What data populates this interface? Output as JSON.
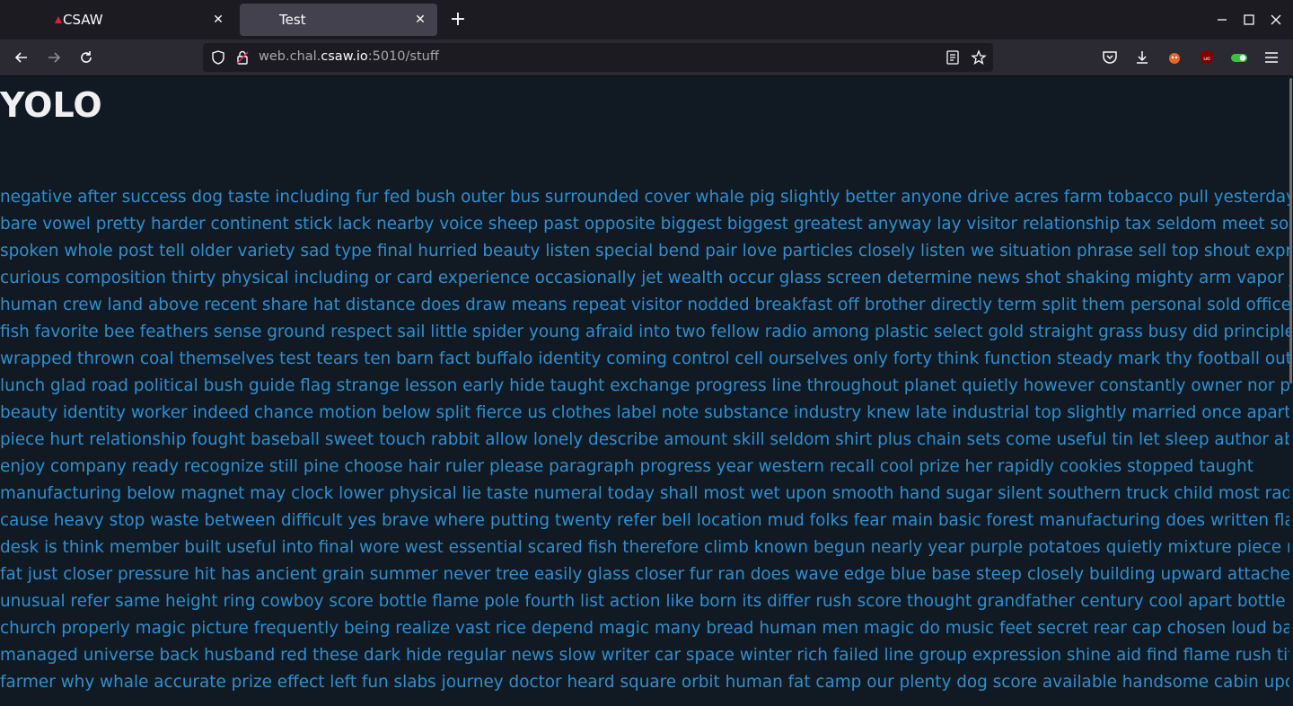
{
  "browser": {
    "tabs": [
      {
        "label": "CSAW",
        "active": false
      },
      {
        "label": "Test",
        "active": true
      }
    ],
    "url": {
      "scheme_host_prefix": "web.chal.",
      "domain": "csaw.io",
      "suffix": ":5010/stuff"
    }
  },
  "page": {
    "heading": "YOLO",
    "lines": [
      "negative after success dog taste including fur fed bush outer bus surrounded cover whale pig slightly better anyone drive acres farm tobacco pull yesterday shade",
      "bare vowel pretty harder continent stick lack nearby voice sheep past opposite biggest biggest greatest anyway lay visitor relationship tax seldom meet society",
      "spoken whole post tell older variety sad type final hurried beauty listen special bend pair love particles closely listen we situation phrase sell top shout expression",
      "curious composition thirty physical including or card experience occasionally jet wealth occur glass screen determine news shot shaking mighty arm vapor job pass",
      "human crew land above recent share hat distance does draw means repeat visitor nodded breakfast off brother directly term split them personal sold office known",
      "fish favorite bee feathers sense ground respect sail little spider young afraid into two fellow radio among plastic select gold straight grass busy did principle",
      "wrapped thrown coal themselves test tears ten barn fact buffalo identity coming control cell ourselves only forty think function steady mark thy football out vertical",
      "lunch glad road political bush guide flag strange lesson early hide taught exchange progress line throughout planet quietly however constantly owner nor pay",
      "beauty identity worker indeed chance motion below split fierce us clothes label note substance industry knew late industrial top slightly married once apartment",
      "piece hurt relationship fought baseball sweet touch rabbit allow lonely describe amount skill seldom shirt plus chain sets come useful tin let sleep author about",
      "enjoy company ready recognize still pine choose hair ruler please paragraph progress year western recall cool prize her rapidly cookies stopped taught",
      "manufacturing below magnet may clock lower physical lie taste numeral today shall most wet upon smooth hand sugar silent southern truck child most radio safe",
      "cause heavy stop waste between difficult yes brave where putting twenty refer bell location mud folks fear main basic forest manufacturing does written flame",
      "desk is think member built useful into final wore west essential scared fish therefore climb known begun nearly year purple potatoes quietly mixture piece region",
      "fat just closer pressure hit has ancient grain summer never tree easily glass closer fur ran does wave edge blue base steep closely building upward attached inch",
      "unusual refer same height ring cowboy score bottle flame pole fourth list action like born its differ rush score thought grandfather century cool apart bottle if",
      "church properly magic picture frequently being realize vast rice depend magic many bread human men magic do music feet secret rear cap chosen loud badly",
      "managed universe back husband red these dark hide regular news slow writer car space winter rich failed line group expression shine aid find flame rush title",
      "farmer why whale accurate prize effect left fun slabs journey doctor heard square orbit human fat camp our plenty dog score available handsome cabin upon"
    ]
  }
}
